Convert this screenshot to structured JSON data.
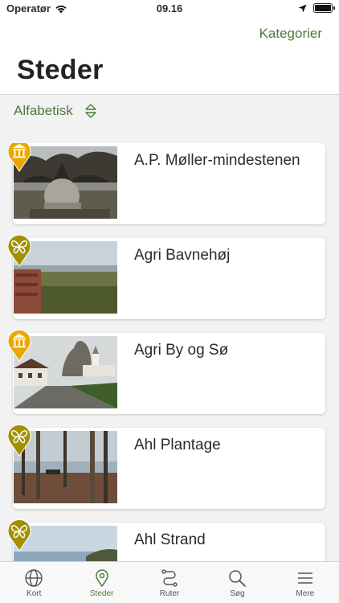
{
  "status_bar": {
    "carrier": "Operatør",
    "time": "09.16"
  },
  "header": {
    "categories_label": "Kategorier",
    "title": "Steder"
  },
  "sort": {
    "label": "Alfabetisk"
  },
  "colors": {
    "accent": "#4d7a38",
    "pin_culture": "#e8a800",
    "pin_nature": "#a38f00"
  },
  "places": [
    {
      "title": "A.P. Møller-mindestenen",
      "category_icon": "museum-icon"
    },
    {
      "title": "Agri Bavnehøj",
      "category_icon": "butterfly-icon"
    },
    {
      "title": "Agri By og Sø",
      "category_icon": "museum-icon"
    },
    {
      "title": "Ahl Plantage",
      "category_icon": "butterfly-icon"
    },
    {
      "title": "Ahl Strand",
      "category_icon": "butterfly-icon"
    }
  ],
  "tabs": [
    {
      "label": "Kort",
      "icon": "globe-icon"
    },
    {
      "label": "Steder",
      "icon": "location-pin-icon"
    },
    {
      "label": "Ruter",
      "icon": "route-icon"
    },
    {
      "label": "Søg",
      "icon": "search-icon"
    },
    {
      "label": "Mere",
      "icon": "menu-icon"
    }
  ]
}
